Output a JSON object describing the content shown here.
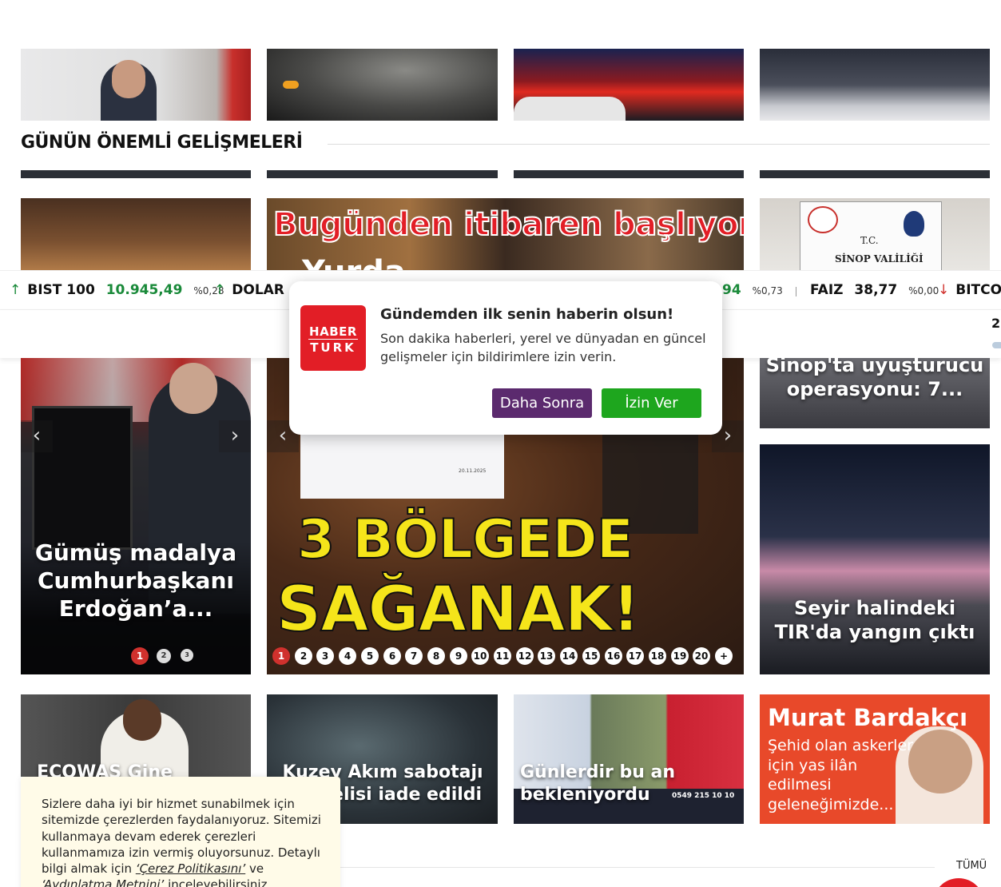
{
  "section": {
    "title": "GÜNÜN ÖNEMLİ GELİŞMELERİ"
  },
  "ticker": {
    "bist_label": "BIST 100",
    "bist_value": "10.945,49",
    "bist_pct": "%0,28",
    "dolar_label": "DOLAR",
    "partial_value": "94",
    "partial_pct": "%0,73",
    "faiz_label": "FAIZ",
    "faiz_value": "38,77",
    "faiz_pct": "%0,00",
    "bitcoin_label": "BITCO",
    "subbar_text": "2"
  },
  "banner": {
    "headline": "Bugünden itibaren başlıyor",
    "sub": "Yurda"
  },
  "cards": {
    "sinop_label1": "T.C.",
    "sinop_label2": "SİNOP VALİLİĞİ",
    "sinop_headline": "Sinop'ta uyuşturucu operasyonu: 7...",
    "erdogan_headline": "Gümüş madalya Cumhurbaşkanı Erdoğan’a...",
    "weather_line1": "3 BÖLGEDE",
    "weather_line2": "SAĞANAK!",
    "weather_map_date": "20.11.2025",
    "tir_headline": "Seyir halindeki TIR'da yangın çıktı",
    "ecowas_headline": "ECOWAS Gine",
    "kuzey_headline": "Kuzey Akım sabotajı şüphelisi iade edildi",
    "gunler_headline": "Günlerdir bu an bekleniyordu",
    "gunler_phone": "0549 215 10 10",
    "bardakci_name": "Murat Bardakçı",
    "bardakci_text": "Şehid olan askerler için yas ilân edilmesi geleneğimizde..."
  },
  "slider_left": {
    "dots": [
      "1",
      "2",
      "3"
    ],
    "prev": "‹",
    "next": "›"
  },
  "slider_main": {
    "dots": [
      "1",
      "2",
      "3",
      "4",
      "5",
      "6",
      "7",
      "8",
      "9",
      "10",
      "11",
      "12",
      "13",
      "14",
      "15",
      "16",
      "17",
      "18",
      "19",
      "20"
    ],
    "more": "+",
    "prev": "‹",
    "next": "›"
  },
  "notification": {
    "logo_top": "HABER",
    "logo_bottom": "TURK",
    "title": "Gündemden ilk senin haberin olsun!",
    "text": "Son dakika haberleri, yerel ve dünyadan en güncel gelişmeler için bildirimlere izin verin.",
    "later_button": "Daha Sonra",
    "allow_button": "İzin Ver"
  },
  "cookie": {
    "text_before": "Sizlere daha iyi bir hizmet sunabilmek için sitemizde çerezlerden faydalanıyoruz. Sitemizi kullanmaya devam ederek çerezleri kullanmamıza izin vermiş oluyorsunuz. Detaylı bilgi almak için ",
    "link1": "‘Çerez Politikasını’",
    "mid": " ve ",
    "link2": "‘Aydınlatma Metnini’",
    "after": " inceleyebilirsiniz."
  },
  "tumu": "TÜMÜ",
  "colors": {
    "brand_red": "#e21e26",
    "up_green": "#1a8a3a",
    "later_purple": "#5b2a6e",
    "allow_green": "#1ea61e"
  }
}
